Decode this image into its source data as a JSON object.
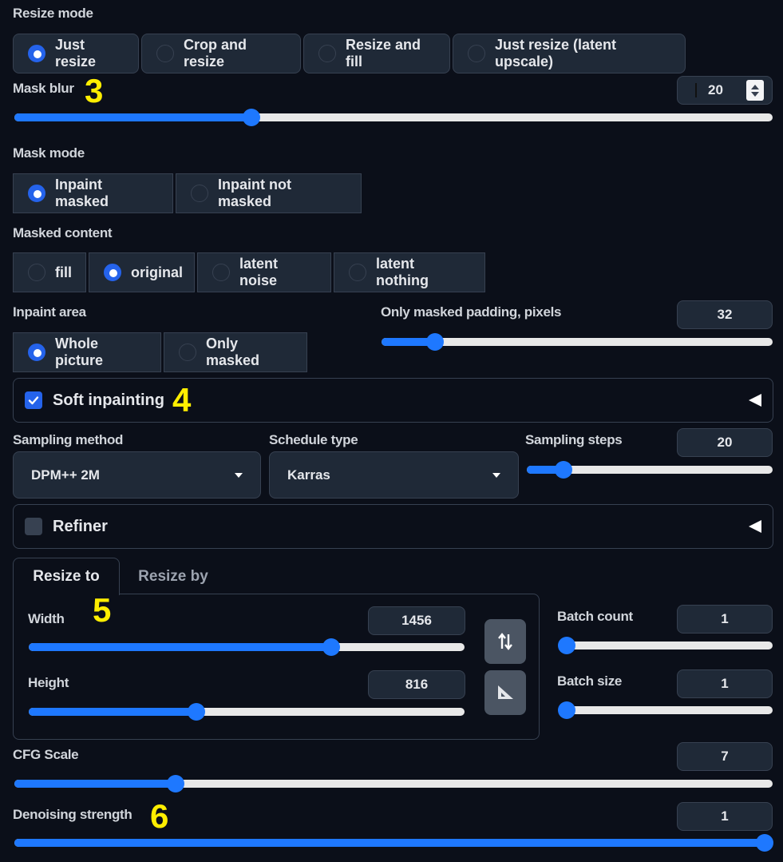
{
  "resize_mode": {
    "label": "Resize mode",
    "options": [
      "Just resize",
      "Crop and resize",
      "Resize and fill",
      "Just resize (latent upscale)"
    ],
    "selected": "Just resize"
  },
  "mask_blur": {
    "label": "Mask blur",
    "value": "20",
    "fraction": 0.3125,
    "annotation": "3"
  },
  "mask_mode": {
    "label": "Mask mode",
    "options": [
      "Inpaint masked",
      "Inpaint not masked"
    ],
    "selected": "Inpaint masked"
  },
  "masked_content": {
    "label": "Masked content",
    "options": [
      "fill",
      "original",
      "latent noise",
      "latent nothing"
    ],
    "selected": "original"
  },
  "inpaint_area": {
    "label": "Inpaint area",
    "options": [
      "Whole picture",
      "Only masked"
    ],
    "selected": "Whole picture"
  },
  "only_masked_padding": {
    "label": "Only masked padding, pixels",
    "value": "32",
    "fraction": 0.137
  },
  "soft_inpainting": {
    "label": "Soft inpainting",
    "checked": true,
    "annotation": "4"
  },
  "sampling_method": {
    "label": "Sampling method",
    "value": "DPM++ 2M"
  },
  "schedule_type": {
    "label": "Schedule type",
    "value": "Karras"
  },
  "sampling_steps": {
    "label": "Sampling steps",
    "value": "20",
    "fraction": 0.15
  },
  "refiner": {
    "label": "Refiner",
    "checked": false
  },
  "resize_tabs": {
    "tabs": [
      "Resize to",
      "Resize by"
    ],
    "active": "Resize to",
    "annotation": "5"
  },
  "width": {
    "label": "Width",
    "value": "1456",
    "fraction": 0.695
  },
  "height": {
    "label": "Height",
    "value": "816",
    "fraction": 0.385
  },
  "swap_icon": "swap-dimensions-icon",
  "ratio_icon": "aspect-ratio-icon",
  "batch_count": {
    "label": "Batch count",
    "value": "1",
    "fraction": 0.0
  },
  "batch_size": {
    "label": "Batch size",
    "value": "1",
    "fraction": 0.0
  },
  "cfg_scale": {
    "label": "CFG Scale",
    "value": "7",
    "fraction": 0.213
  },
  "denoising_strength": {
    "label": "Denoising strength",
    "value": "1",
    "fraction": 1.0,
    "annotation": "6"
  },
  "colors": {
    "accent": "#1e78ff",
    "background": "#0b0f19",
    "panel": "#1f2937",
    "annotation": "#ffee00"
  }
}
